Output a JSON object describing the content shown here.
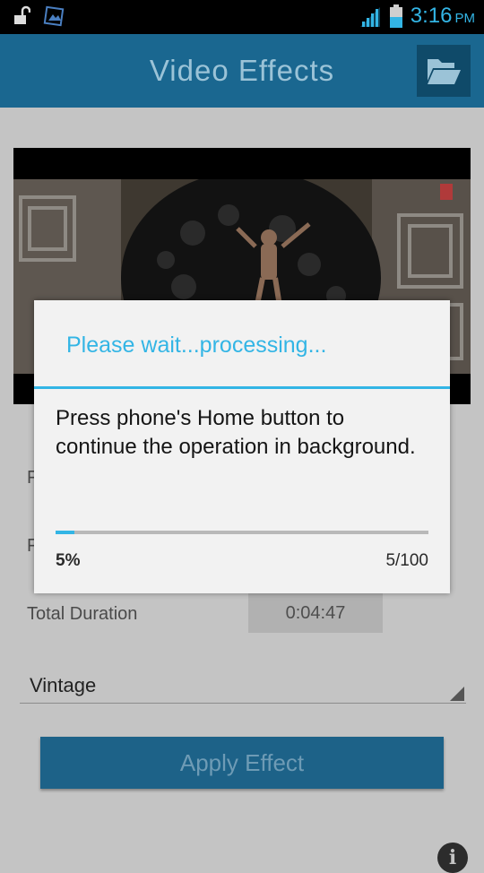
{
  "status_bar": {
    "time": "3:16",
    "ampm": "PM",
    "icons": [
      "lock-open-icon",
      "image-notification-icon",
      "signal-icon",
      "battery-icon"
    ],
    "accent": "#33b5e5"
  },
  "app_bar": {
    "title": "Video Effects",
    "folder_icon": "folder-open-icon",
    "background": "#1a6790"
  },
  "form": {
    "row1_label": "F",
    "row2_label": "F",
    "total_duration_label": "Total Duration",
    "total_duration_value": "0:04:47"
  },
  "effect_spinner": {
    "selected": "Vintage"
  },
  "apply_button": {
    "label": "Apply Effect"
  },
  "dialog": {
    "title": "Please wait...processing...",
    "message": "Press phone's Home button to continue the operation in background.",
    "progress_fraction": 0.05,
    "percent_label": "5%",
    "count_label": "5/100"
  }
}
